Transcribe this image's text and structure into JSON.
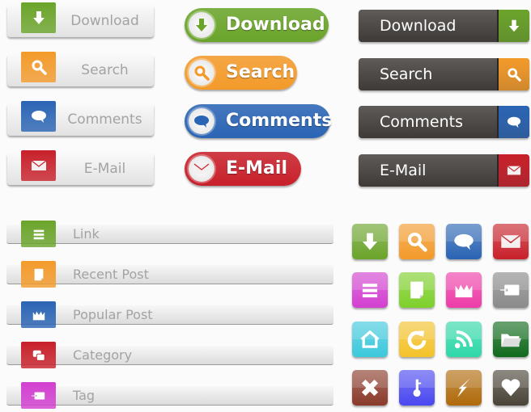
{
  "colors": {
    "green": "#6aa42a",
    "orange": "#f39a2a",
    "blue": "#2a64b4",
    "red": "#c8202a"
  },
  "light_buttons": [
    {
      "label": "Download",
      "icon": "download-icon",
      "color": "#6aa42a"
    },
    {
      "label": "Search",
      "icon": "search-icon",
      "color": "#f39a2a"
    },
    {
      "label": "Comments",
      "icon": "comment-icon",
      "color": "#2a64b4"
    },
    {
      "label": "E-Mail",
      "icon": "mail-icon",
      "color": "#c8202a"
    }
  ],
  "pill_buttons": [
    {
      "label": "Download",
      "icon": "download-icon",
      "color": "#6aa42a"
    },
    {
      "label": "Search",
      "icon": "search-icon",
      "color": "#f39a2a"
    },
    {
      "label": "Comments",
      "icon": "comment-icon",
      "color": "#2a64b4"
    },
    {
      "label": "E-Mail",
      "icon": "mail-icon",
      "color": "#c8202a"
    }
  ],
  "dark_buttons": [
    {
      "label": "Download",
      "icon": "download-icon",
      "color": "#6aa42a"
    },
    {
      "label": "Search",
      "icon": "search-icon",
      "color": "#f39a2a"
    },
    {
      "label": "Comments",
      "icon": "comment-icon",
      "color": "#2a64b4"
    },
    {
      "label": "E-Mail",
      "icon": "mail-icon",
      "color": "#c8202a"
    }
  ],
  "list_items": [
    {
      "label": "Link",
      "icon": "list-icon",
      "color": "#6aa42a"
    },
    {
      "label": "Recent Post",
      "icon": "page-icon",
      "color": "#f39a2a"
    },
    {
      "label": "Popular Post",
      "icon": "crown-icon",
      "color": "#2a64b4"
    },
    {
      "label": "Category",
      "icon": "category-icon",
      "color": "#c8202a"
    },
    {
      "label": "Tag",
      "icon": "tag-icon",
      "color": "#d23fd0"
    }
  ],
  "icon_tiles": [
    {
      "icon": "download-icon",
      "color": "#6aa42a"
    },
    {
      "icon": "search-icon",
      "color": "#f39a2a"
    },
    {
      "icon": "comment-icon",
      "color": "#2a64b4"
    },
    {
      "icon": "mail-icon",
      "color": "#c8202a"
    },
    {
      "icon": "list-icon",
      "color": "#d23fd0"
    },
    {
      "icon": "page-icon",
      "color": "#7ed02a"
    },
    {
      "icon": "crown-icon",
      "color": "#ee3ca8"
    },
    {
      "icon": "tag-icon",
      "color": "#8a8a8a"
    },
    {
      "icon": "home-icon",
      "color": "#3cc8dc"
    },
    {
      "icon": "refresh-icon",
      "color": "#f4c22a"
    },
    {
      "icon": "rss-icon",
      "color": "#2ed8a8"
    },
    {
      "icon": "folder-icon",
      "color": "#106a1c"
    },
    {
      "icon": "close-icon",
      "color": "#8a3a2a"
    },
    {
      "icon": "key-icon",
      "color": "#4a48f0"
    },
    {
      "icon": "lightning-icon",
      "color": "#b06a0a"
    },
    {
      "icon": "heart-icon",
      "color": "#4a4438"
    }
  ]
}
